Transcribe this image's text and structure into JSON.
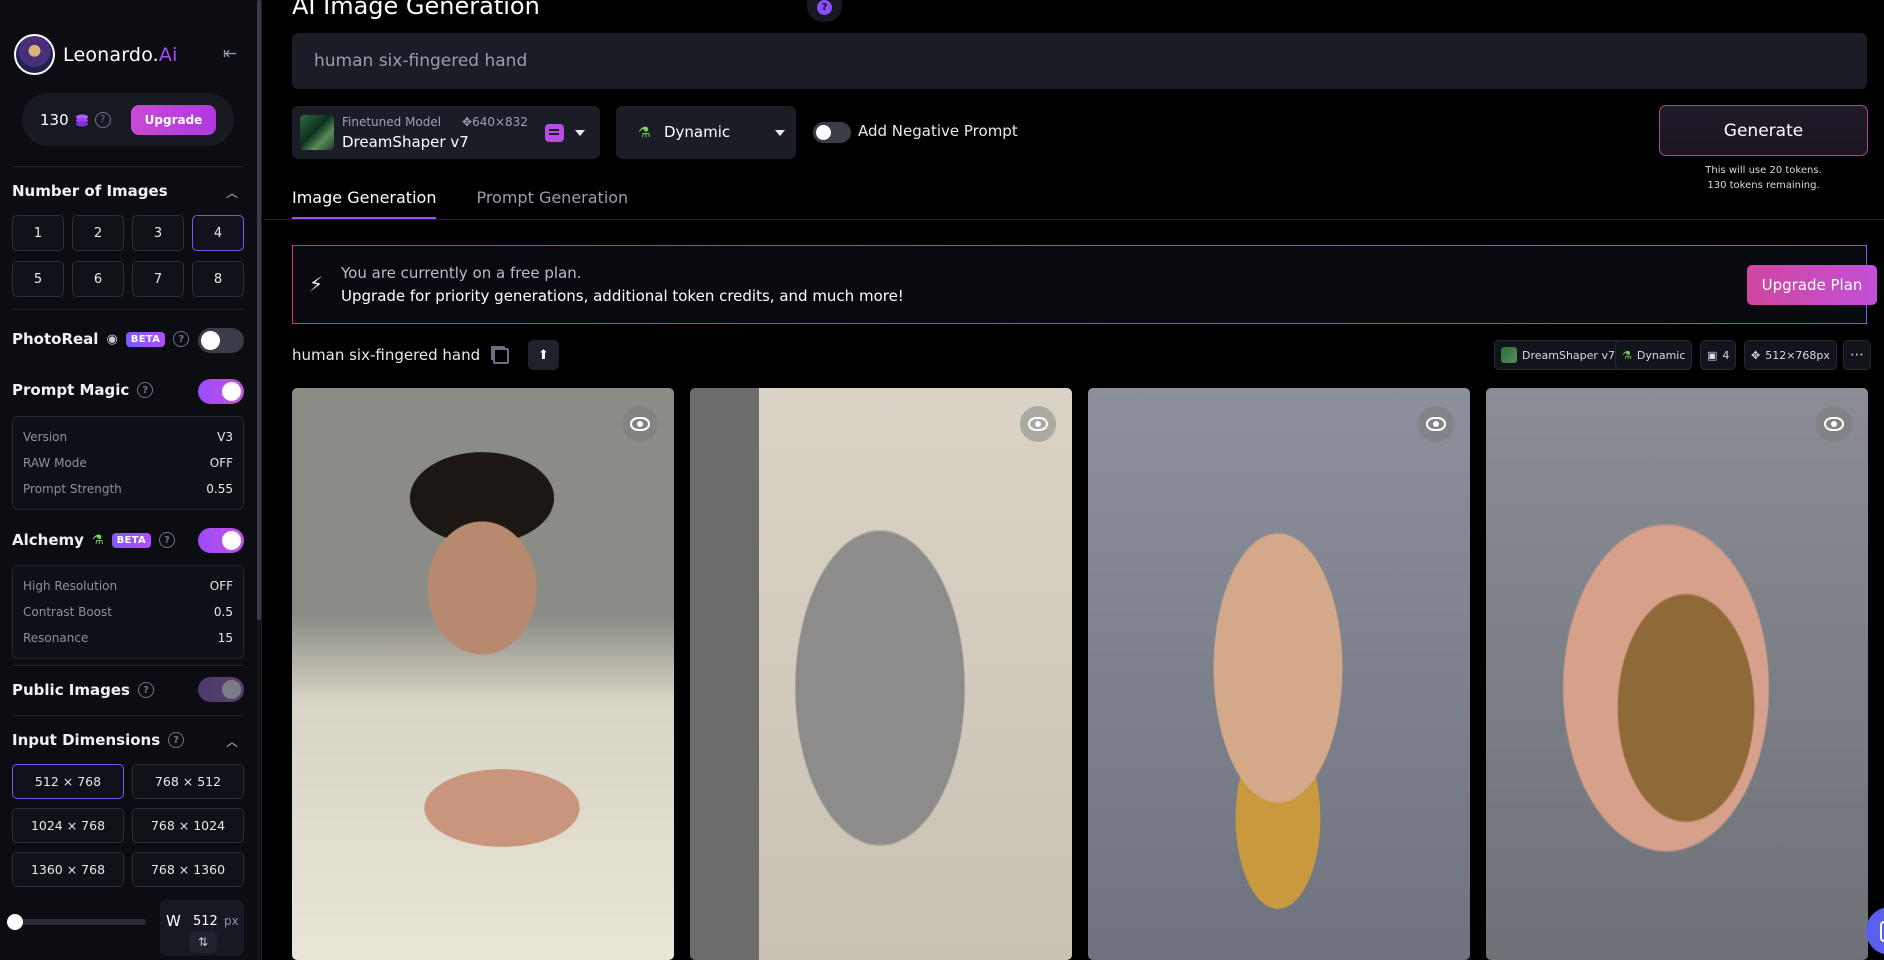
{
  "brand": {
    "name": "Leonardo.",
    "ai": "Ai"
  },
  "tokens": {
    "count": "130",
    "upgrade": "Upgrade"
  },
  "num_images": {
    "title": "Number of Images",
    "options": [
      "1",
      "2",
      "3",
      "4",
      "5",
      "6",
      "7",
      "8"
    ],
    "selected": "4"
  },
  "photoreal": {
    "label": "PhotoReal",
    "badge": "BETA",
    "enabled": false
  },
  "prompt_magic": {
    "label": "Prompt Magic",
    "enabled": true,
    "settings": [
      {
        "key": "Version",
        "value": "V3"
      },
      {
        "key": "RAW Mode",
        "value": "OFF"
      },
      {
        "key": "Prompt Strength",
        "value": "0.55"
      }
    ]
  },
  "alchemy": {
    "label": "Alchemy",
    "badge": "BETA",
    "enabled": true,
    "settings": [
      {
        "key": "High Resolution",
        "value": "OFF"
      },
      {
        "key": "Contrast Boost",
        "value": "0.5"
      },
      {
        "key": "Resonance",
        "value": "15"
      }
    ]
  },
  "public_images": {
    "label": "Public Images",
    "enabled": true
  },
  "input_dimensions": {
    "title": "Input Dimensions",
    "options": [
      "512 × 768",
      "768 × 512",
      "1024 × 768",
      "768 × 1024",
      "1360 × 768",
      "768 × 1360"
    ],
    "selected": "512 × 768"
  },
  "width": {
    "label": "W",
    "value": "512",
    "unit": "px"
  },
  "header": {
    "title": "AI Image Generation"
  },
  "prompt": {
    "value": "human six-fingered hand"
  },
  "model": {
    "kind": "Finetuned Model",
    "dims": "640×832",
    "name": "DreamShaper v7"
  },
  "style": {
    "label": "Dynamic"
  },
  "negative_prompt": {
    "label": "Add Negative Prompt",
    "enabled": false
  },
  "generate": {
    "label": "Generate",
    "note_line1": "This will use 20 tokens.",
    "note_line2": "130 tokens remaining."
  },
  "tabs": [
    "Image Generation",
    "Prompt Generation"
  ],
  "banner": {
    "line1": "You are currently on a free plan.",
    "line2": "Upgrade for priority generations, additional token credits, and much more!",
    "button": "Upgrade Plan"
  },
  "generation": {
    "prompt": "human six-fingered hand",
    "chips": {
      "model": "DreamShaper v7",
      "style": "Dynamic",
      "count": "4",
      "size": "512×768px"
    }
  },
  "images": [
    {
      "name": "image-man-hand-gesture"
    },
    {
      "name": "image-grey-hands"
    },
    {
      "name": "image-ornate-gold-hand"
    },
    {
      "name": "image-mechanical-hand"
    }
  ],
  "colors": {
    "accent": "#a64bff",
    "upgrade": "#c84ad6",
    "background": "#000000"
  }
}
